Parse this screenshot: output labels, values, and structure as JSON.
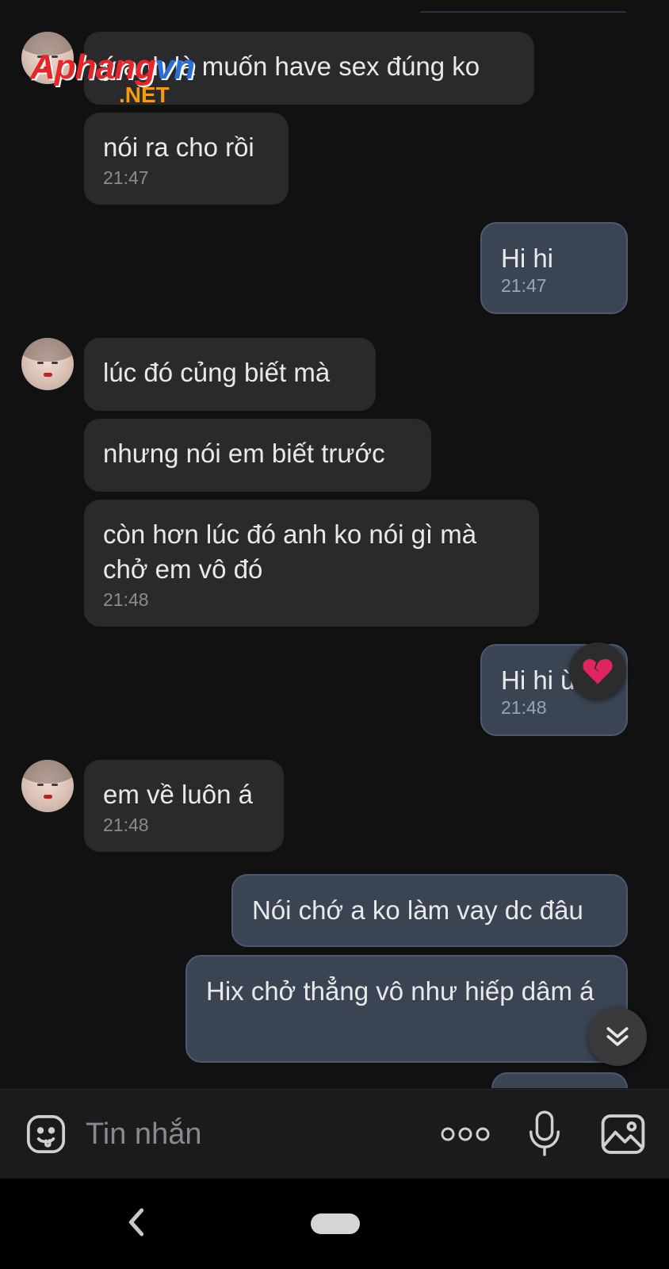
{
  "watermark": {
    "main_red": "A",
    "main_rest": "phang",
    "main_blue": "vn",
    "net": ".NET"
  },
  "messages": [
    {
      "text": "ý anh là muốn have sex đúng ko",
      "time": ""
    },
    {
      "text": "nói ra cho rồi",
      "time": "21:47"
    },
    {
      "text": "Hi hi",
      "time": "21:47"
    },
    {
      "text": "lúc đó củng biết mà",
      "time": ""
    },
    {
      "text": "nhưng nói em biết trước",
      "time": ""
    },
    {
      "text": "còn hơn lúc đó anh ko nói gì mà chở em vô đó",
      "time": "21:48"
    },
    {
      "text": "Hi hi ừ",
      "time": "21:48"
    },
    {
      "text": "em về luôn á",
      "time": "21:48"
    },
    {
      "text": "Nói chớ a ko làm vay dc đâu",
      "time": ""
    },
    {
      "text": "Hix chở thẳng vô như hiếp dâm á",
      "time": ""
    }
  ],
  "reaction": {
    "icon": "broken-heart-icon",
    "color": "#e0245e"
  },
  "input": {
    "placeholder": "Tin nhắn"
  },
  "icons": {
    "emoji": "sticker-face-icon",
    "more": "more-dots-icon",
    "mic": "microphone-icon",
    "image": "image-icon",
    "scroll": "double-chevron-down-icon",
    "back": "back-chevron-icon",
    "home": "home-pill-icon"
  },
  "colors": {
    "background": "#111112",
    "incoming_bubble": "#2a2a2c",
    "outgoing_bubble": "#3a4453"
  }
}
